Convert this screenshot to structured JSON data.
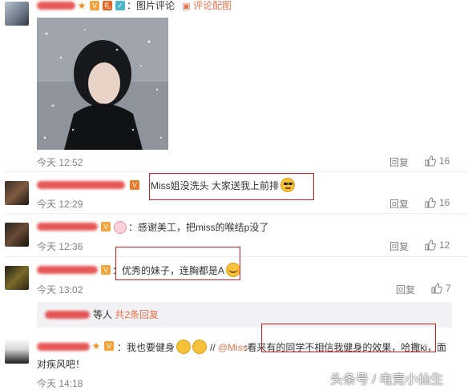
{
  "comments": [
    {
      "meta_label": "：图片评论",
      "meta_link": "评论配图",
      "time": "今天 12:52",
      "reply": "回复",
      "likes": "16"
    },
    {
      "text": "Miss姐没洗头  大家送我上前排",
      "time": "今天 12:29",
      "reply": "回复",
      "likes": "16"
    },
    {
      "text": "：感谢美工，把miss的喉结p没了",
      "time": "今天 12:36",
      "reply": "回复",
      "likes": "12"
    },
    {
      "text": "：优秀的妹子，连胸都是A",
      "time": "今天 13:02",
      "reply": "回复",
      "likes": "7"
    },
    {
      "line1_a": "：我也要健身",
      "line1_b": "//",
      "line1_mention": "@Miss",
      "line1_c": ":看来有的同学不相信我健身的效果，哈撒ki，面",
      "line2": "对疾风吧！",
      "time": "今天 14:18"
    }
  ],
  "subreplies": {
    "suffix": "等人",
    "count_link": "共2条回复"
  },
  "watermark": "头条号 / 电竞小仙生",
  "colors": {
    "link": "#eb7350",
    "highlight_box": "#e0191d",
    "muted": "#808080"
  },
  "icons": [
    "thumbs-up-icon",
    "vip-crown-icon",
    "star-icon",
    "emoji-icon"
  ]
}
